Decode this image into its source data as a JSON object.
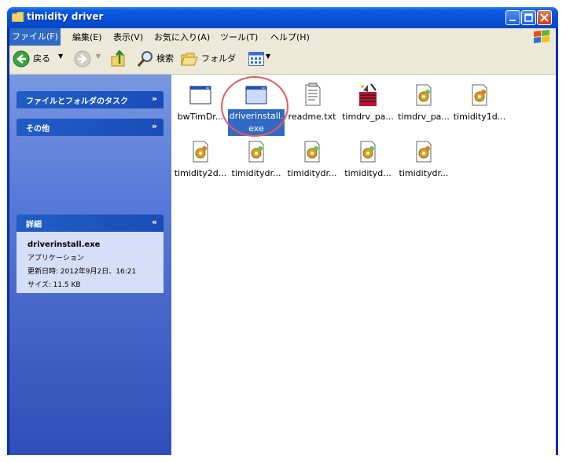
{
  "window": {
    "title": "timidity driver"
  },
  "menu": [
    "ファイル(F)",
    "編集(E)",
    "表示(V)",
    "お気に入り(A)",
    "ツール(T)",
    "ヘルプ(H)"
  ],
  "toolbar": {
    "back_label": "戻る",
    "search_label": "検索",
    "folders_label": "フォルダ"
  },
  "taskpane": {
    "panel_tasks": "ファイルとフォルダのタスク",
    "panel_other": "その他",
    "panel_details": "詳細",
    "details": {
      "filename": "driverinstall.exe",
      "type": "アプリケーション",
      "modified": "更新日時: 2012年9月2日、16:21",
      "size": "サイズ: 11.5 KB"
    }
  },
  "files": [
    {
      "label": "bwTimDr...",
      "icon": "app-window-icon"
    },
    {
      "label": "driverinstall.exe",
      "line1": "driverinstall.",
      "line2": "exe",
      "icon": "app-window-icon",
      "selected": true
    },
    {
      "label": "readme.txt",
      "icon": "text-file-icon"
    },
    {
      "label": "timdrv_pa...",
      "icon": "speaker-icon"
    },
    {
      "label": "timdrv_pa...",
      "icon": "settings-file-icon"
    },
    {
      "label": "timidity1d...",
      "icon": "settings-file-icon"
    },
    {
      "label": "timidity2d...",
      "icon": "settings-file-icon"
    },
    {
      "label": "timiditydr...",
      "icon": "settings-file-icon"
    },
    {
      "label": "timiditydr...",
      "icon": "settings-file-icon"
    },
    {
      "label": "timidityd...",
      "icon": "settings-file-icon"
    },
    {
      "label": "timiditydr...",
      "icon": "settings-file-icon"
    }
  ]
}
